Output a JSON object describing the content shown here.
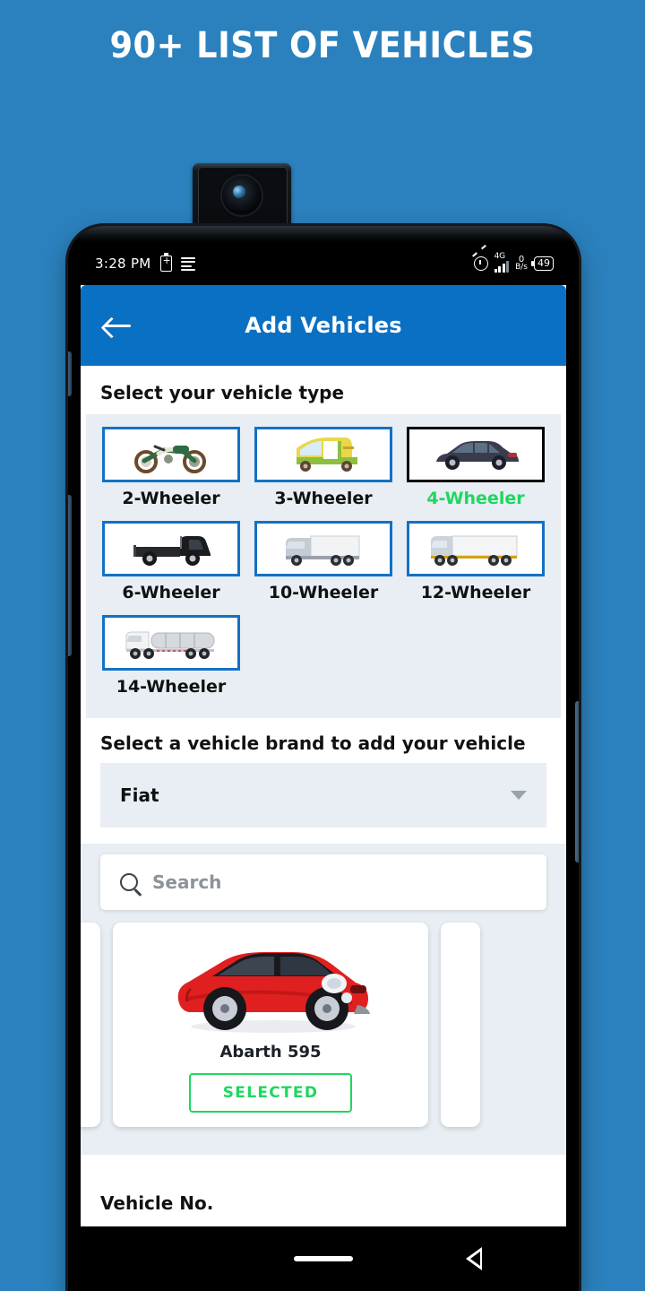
{
  "promo": {
    "title": "90+ LIST OF VEHICLES"
  },
  "status_bar": {
    "time": "3:28 PM",
    "battery_add_icon": "battery-add-icon",
    "notes_icon": "notes-icon",
    "alarm_icon": "alarm-icon",
    "network_type": "4G",
    "net_speed_value": "0",
    "net_speed_unit": "B/s",
    "battery_level": "49"
  },
  "appbar": {
    "back_icon": "back-arrow-icon",
    "title": "Add Vehicles"
  },
  "vehicle_type": {
    "heading": "Select your vehicle type",
    "items": [
      {
        "label": "2-Wheeler",
        "icon": "motorcycle-icon",
        "selected": false
      },
      {
        "label": "3-Wheeler",
        "icon": "auto-rickshaw-icon",
        "selected": false
      },
      {
        "label": "4-Wheeler",
        "icon": "car-icon",
        "selected": true
      },
      {
        "label": "6-Wheeler",
        "icon": "pickup-truck-icon",
        "selected": false
      },
      {
        "label": "10-Wheeler",
        "icon": "box-truck-icon",
        "selected": false
      },
      {
        "label": "12-Wheeler",
        "icon": "trailer-truck-icon",
        "selected": false
      },
      {
        "label": "14-Wheeler",
        "icon": "tanker-truck-icon",
        "selected": false
      }
    ]
  },
  "brand": {
    "heading": "Select a vehicle brand to add your vehicle",
    "selected": "Fiat",
    "chevron_icon": "chevron-down-icon"
  },
  "search": {
    "icon": "search-icon",
    "placeholder": "Search",
    "value": ""
  },
  "vehicle_card": {
    "name": "Abarth 595",
    "image": "red-abarth-595-car-photo",
    "button_label": "SELECTED",
    "button_state": "selected"
  },
  "next_field": {
    "label": "Vehicle No."
  },
  "navbar": {
    "home_pill": "home-pill-icon",
    "back_icon": "nav-back-icon"
  },
  "colors": {
    "page_background": "#2b81bd",
    "appbar_blue": "#0a70c3",
    "accent_green": "#1ed760",
    "panel_gray": "#e8eef3",
    "border_blue": "#1471c4",
    "selected_border": "#000000"
  }
}
